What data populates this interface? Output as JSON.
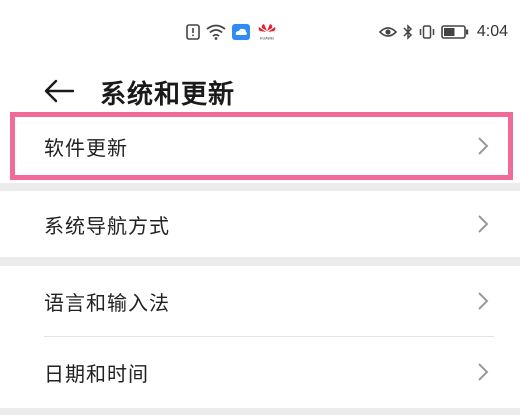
{
  "status_bar": {
    "time": "4:04",
    "brand_text": "HUAWEI",
    "icons_center": [
      "notification-alert-icon",
      "wifi-icon",
      "cloud-icon",
      "huawei-logo-icon"
    ],
    "icons_right": [
      "eye-icon",
      "bluetooth-icon",
      "vibrate-icon",
      "battery-icon"
    ],
    "battery_level": 0.55
  },
  "header": {
    "back_icon": "arrow-left-icon",
    "title": "系统和更新"
  },
  "list": {
    "items": [
      {
        "label": "软件更新",
        "icon": "chevron-right-icon",
        "highlighted": true
      },
      {
        "label": "系统导航方式",
        "icon": "chevron-right-icon"
      },
      {
        "label": "语言和输入法",
        "icon": "chevron-right-icon"
      },
      {
        "label": "日期和时间",
        "icon": "chevron-right-icon"
      }
    ]
  },
  "colors": {
    "highlight": "#f06b98",
    "background": "#ececec",
    "card": "#ffffff",
    "cloud": "#2f8cf5",
    "huawei": "#e8212e"
  }
}
